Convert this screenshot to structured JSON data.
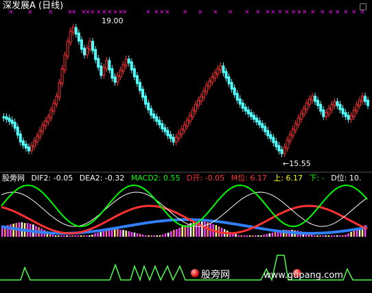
{
  "header": {
    "title": "深发展A (日线)"
  },
  "price_panel": {
    "high_label": "19.00",
    "low_label": "←15.55"
  },
  "indicator_legend": {
    "name": "股旁网",
    "dif2": "DIF2: -0.05",
    "dea2": "DEA2: -0.32",
    "macd2": "MACD2: 0.55",
    "d_open": "D开: -0.05",
    "m_pos": "M位: 6.17",
    "up": "上: 6.17",
    "down": "下: -",
    "d_pos": "D位: 10."
  },
  "watermark": {
    "cn": "股旁网",
    "url": "www.gupang.com"
  },
  "colors": {
    "up_candle": "#ff3232",
    "down_candle": "#54fcfc",
    "marker": "#ff00ff",
    "dif_line": "#ffffff",
    "dea_line": "#ffff00",
    "macd_green": "#00ff00",
    "signal_green": "#4cff4c"
  },
  "icons": {
    "top_right": "square-icon",
    "watermark_logo": "red-ball-icon"
  }
}
